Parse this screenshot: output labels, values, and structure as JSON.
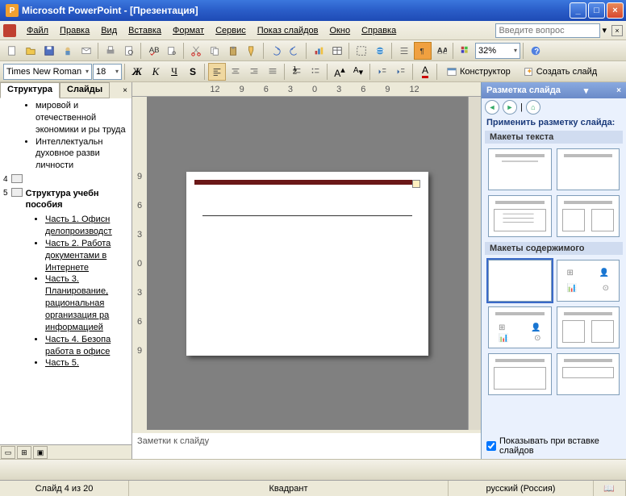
{
  "title": "Microsoft PowerPoint - [Презентация]",
  "menus": [
    "Файл",
    "Правка",
    "Вид",
    "Вставка",
    "Формат",
    "Сервис",
    "Показ слайдов",
    "Окно",
    "Справка"
  ],
  "help_placeholder": "Введите вопрос",
  "font": {
    "name": "Times New Roman",
    "size": "18"
  },
  "zoom": "32%",
  "designer_label": "Конструктор",
  "newslide_label": "Создать слайд",
  "tabs": {
    "outline": "Структура",
    "slides": "Слайды"
  },
  "outline": {
    "bullets_top": [
      "мировой и отечественной экономики и ры труда",
      "Интеллектуальн духовное разви личности"
    ],
    "slide4_num": "4",
    "slide5_num": "5",
    "slide5_title": "Структура учебн пособия",
    "links": [
      "Часть 1. Офисн делопроизводст",
      "Часть 2. Работа документами в Интернете",
      "Часть 3. Планирование, рациональная организация ра информацией",
      "Часть 4. Безопа работа в офисе",
      "Часть 5."
    ]
  },
  "ruler_h": [
    "12",
    "9",
    "6",
    "3",
    "0",
    "3",
    "6",
    "9",
    "12"
  ],
  "ruler_v": [
    "9",
    "6",
    "3",
    "0",
    "3",
    "6",
    "9"
  ],
  "notes_placeholder": "Заметки к слайду",
  "taskpane": {
    "title": "Разметка слайда",
    "apply": "Применить разметку слайда:",
    "sec1": "Макеты текста",
    "sec2": "Макеты содержимого",
    "footer": "Показывать при вставке слайдов"
  },
  "status": {
    "slide": "Слайд 4 из 20",
    "design": "Квадрант",
    "lang": "русский (Россия)"
  }
}
